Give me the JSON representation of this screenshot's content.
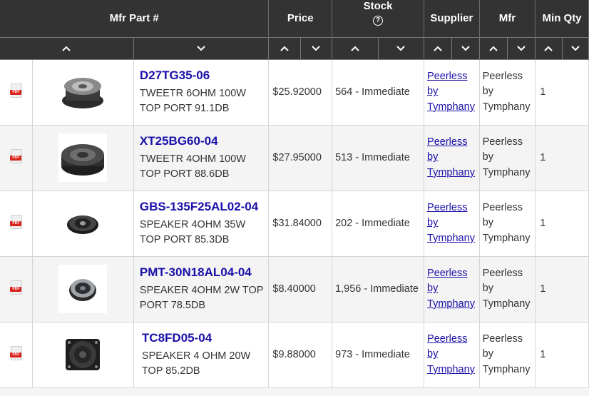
{
  "header": {
    "mfr_part": "Mfr Part #",
    "price": "Price",
    "stock": "Stock",
    "stock_help_icon": "question-circle-icon",
    "supplier": "Supplier",
    "mfr": "Mfr",
    "min_qty": "Min Qty"
  },
  "sort_icons": {
    "asc": "chevron-up-icon",
    "desc": "chevron-down-icon"
  },
  "pdf_label": "PDF",
  "rows": [
    {
      "part": "D27TG35-06",
      "desc": "TWEETR 6OHM 100W TOP PORT 91.1DB",
      "price": "$25.92000",
      "stock": "564 - Immediate",
      "supplier": [
        "Peerless",
        "by",
        "Tymphany"
      ],
      "mfr": [
        "Peerless",
        "by",
        "Tymphany"
      ],
      "min_qty": "1"
    },
    {
      "part": "XT25BG60-04",
      "desc": "TWEETR 4OHM 100W TOP PORT 88.6DB",
      "price": "$27.95000",
      "stock": "513 - Immediate",
      "supplier": [
        "Peerless",
        "by",
        "Tymphany"
      ],
      "mfr": [
        "Peerless",
        "by",
        "Tymphany"
      ],
      "min_qty": "1"
    },
    {
      "part": "GBS-135F25AL02-04",
      "desc": "SPEAKER 4OHM 35W TOP PORT 85.3DB",
      "price": "$31.84000",
      "stock": "202 - Immediate",
      "supplier": [
        "Peerless",
        "by",
        "Tymphany"
      ],
      "mfr": [
        "Peerless",
        "by",
        "Tymphany"
      ],
      "min_qty": "1"
    },
    {
      "part": "PMT-30N18AL04-04",
      "desc": "SPEAKER 4OHM 2W TOP PORT 78.5DB",
      "price": "$8.40000",
      "stock": "1,956 - Immediate",
      "supplier": [
        "Peerless",
        "by",
        "Tymphany"
      ],
      "mfr": [
        "Peerless",
        "by",
        "Tymphany"
      ],
      "min_qty": "1"
    },
    {
      "part": "TC8FD05-04",
      "desc": "SPEAKER 4 OHM 20W TOP 85.2DB",
      "price": "$9.88000",
      "stock": "973 - Immediate",
      "supplier": [
        "Peerless",
        "by",
        "Tymphany"
      ],
      "mfr": [
        "Peerless",
        "by",
        "Tymphany"
      ],
      "min_qty": "1"
    }
  ]
}
